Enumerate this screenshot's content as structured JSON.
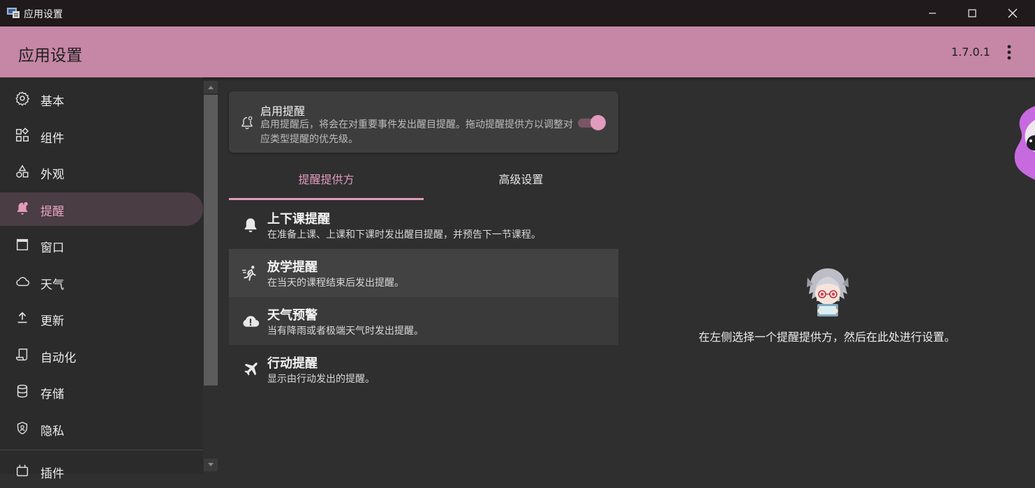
{
  "window": {
    "title": "应用设置"
  },
  "header": {
    "title": "应用设置",
    "version": "1.7.0.1"
  },
  "sidebar": {
    "items": [
      {
        "label": "基本",
        "icon": "gear-icon"
      },
      {
        "label": "组件",
        "icon": "widgets-icon"
      },
      {
        "label": "外观",
        "icon": "shapes-icon"
      },
      {
        "label": "提醒",
        "icon": "bell-badge-icon",
        "active": true
      },
      {
        "label": "窗口",
        "icon": "window-icon"
      },
      {
        "label": "天气",
        "icon": "cloud-icon"
      },
      {
        "label": "更新",
        "icon": "upload-icon"
      },
      {
        "label": "自动化",
        "icon": "script-icon"
      },
      {
        "label": "存储",
        "icon": "database-icon"
      },
      {
        "label": "隐私",
        "icon": "shield-icon"
      },
      {
        "label": "插件",
        "icon": "plugin-icon"
      }
    ]
  },
  "reminder_card": {
    "title": "启用提醒",
    "description": "启用提醒后，将会在对重要事件发出醒目提醒。拖动提醒提供方以调整对应类型提醒的优先级。",
    "enabled": true
  },
  "tabs": [
    {
      "label": "提醒提供方",
      "selected": true
    },
    {
      "label": "高级设置",
      "selected": false
    }
  ],
  "providers": [
    {
      "title": "上下课提醒",
      "description": "在准备上课、上课和下课时发出醒目提醒，并预告下一节课程。",
      "icon": "bell-icon"
    },
    {
      "title": "放学提醒",
      "description": "在当天的课程结束后发出提醒。",
      "icon": "running-person-icon"
    },
    {
      "title": "天气预警",
      "description": "当有降雨或者极端天气时发出提醒。",
      "icon": "cloud-alert-icon"
    },
    {
      "title": "行动提醒",
      "description": "显示由行动发出的提醒。",
      "icon": "airplane-icon"
    }
  ],
  "detail": {
    "empty_hint": "在左侧选择一个提醒提供方，然后在此处进行设置。"
  },
  "colors": {
    "accent": "#e29bbd",
    "header": "#c686a5",
    "titlebar": "#201a1c",
    "background": "#2f2f2f"
  }
}
